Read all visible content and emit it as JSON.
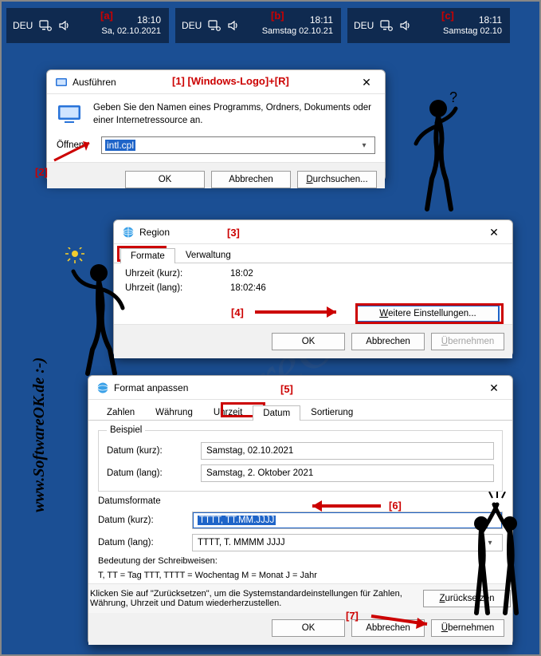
{
  "tray": {
    "lang": "DEU",
    "a": {
      "time": "18:10",
      "date": "Sa, 02.10.2021",
      "callout": "[a]"
    },
    "b": {
      "time": "18:11",
      "date": "Samstag 02.10.21",
      "callout": "[b]"
    },
    "c": {
      "time": "18:11",
      "date": "Samstag 02.10",
      "callout": "[c]"
    }
  },
  "run": {
    "title": "Ausführen",
    "callout1": "[1] [Windows-Logo]+[R]",
    "description": "Geben Sie den Namen eines Programms, Ordners, Dokuments oder einer Internetressource an.",
    "open_label": "Öffnen:",
    "open_value": "intl.cpl",
    "ok": "OK",
    "cancel": "Abbrechen",
    "browse": "Durchsuchen...",
    "callout2": "[2]"
  },
  "region": {
    "title": "Region",
    "callout3": "[3]",
    "tabs": {
      "formate": "Formate",
      "verwaltung": "Verwaltung"
    },
    "rows": [
      {
        "k": "Uhrzeit (kurz):",
        "v": "18:02"
      },
      {
        "k": "Uhrzeit (lang):",
        "v": "18:02:46"
      }
    ],
    "more": "Weitere Einstellungen...",
    "ok": "OK",
    "cancel": "Abbrechen",
    "apply": "Übernehmen",
    "callout4": "[4]"
  },
  "fmt": {
    "title": "Format anpassen",
    "callout5": "[5]",
    "tabs": {
      "zahlen": "Zahlen",
      "waehrung": "Währung",
      "uhrzeit": "Uhrzeit",
      "datum": "Datum",
      "sort": "Sortierung"
    },
    "beispiel_legend": "Beispiel",
    "datum_kurz_label": "Datum (kurz):",
    "datum_kurz_value": "Samstag, 02.10.2021",
    "datum_lang_label": "Datum (lang):",
    "datum_lang_value": "Samstag, 2. Oktober 2021",
    "formats_legend": "Datumsformate",
    "fmt_kurz_label": "Datum (kurz):",
    "fmt_kurz_value": "TTTT, TT.MM.JJJJ",
    "callout6": "[6]",
    "fmt_lang_label": "Datum (lang):",
    "fmt_lang_value": "TTTT, T. MMMM JJJJ",
    "hint1": "Bedeutung der Schreibweisen:",
    "hint2": "T, TT = Tag   TTT, TTTT = Wochentag  M = Monat         J = Jahr",
    "reset_text": "Klicken Sie auf \"Zurücksetzen\", um die Systemstandardeinstellungen für Zahlen, Währung, Uhrzeit und Datum wiederherzustellen.",
    "reset": "Zurücksetzen",
    "ok": "OK",
    "cancel": "Abbrechen",
    "apply": "Übernehmen",
    "callout7": "[7]"
  },
  "watermark": {
    "big": "SoftwareOK",
    "side": "www.SoftwareOK.de :-)",
    "small": "www.SoftwareOK.de :-)"
  }
}
